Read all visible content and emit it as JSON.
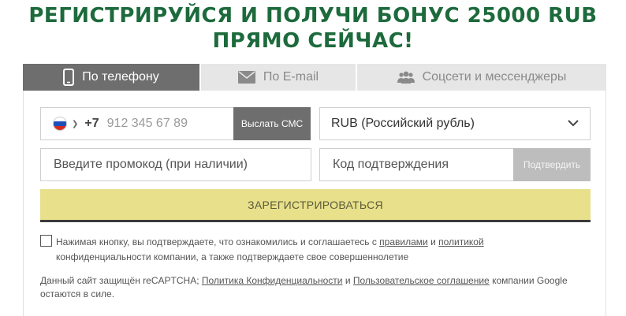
{
  "headline": {
    "line1": "РЕГИСТРИРУЙСЯ И ПОЛУЧИ БОНУС 25000 RUB",
    "line2": "ПРЯМО СЕЙЧАС!",
    "color": "#1d6a3c"
  },
  "tabs": [
    {
      "label": "По телефону",
      "icon": "smartphone-icon",
      "active": true
    },
    {
      "label": "По E-mail",
      "icon": "envelope-icon",
      "active": false
    },
    {
      "label": "Соцсети и мессенджеры",
      "icon": "users-icon",
      "active": false
    }
  ],
  "phone": {
    "country_flag": "russia-flag-icon",
    "prefix": "+7",
    "placeholder": "912 345 67 89",
    "send_sms_label": "Выслать СМС"
  },
  "currency": {
    "selected": "RUB (Российский рубль)"
  },
  "promo": {
    "placeholder": "Введите промокод (при наличии)"
  },
  "confirmation": {
    "placeholder": "Код подтверждения",
    "confirm_label": "Подтвердить"
  },
  "register": {
    "label": "ЗАРЕГИСТРИРОВАТЬСЯ",
    "color": "#e8e08a"
  },
  "agreement": {
    "checked": false,
    "text_before": "Нажимая кнопку, вы подтверждаете, что ознакомились и соглашаетесь с ",
    "rules_link": "правилами",
    "and": " и ",
    "policy_link": "политикой",
    "text_after": " конфиденциальности компании, а также подтверждаете свое совершеннолетие"
  },
  "captcha": {
    "text_before": "Данный сайт защищён reCAPTCHA; ",
    "privacy_link": "Политика Конфиденциальности",
    "and": " и ",
    "terms_link": "Пользовательское соглашение",
    "text_after": " компании Google остаются в силе."
  }
}
